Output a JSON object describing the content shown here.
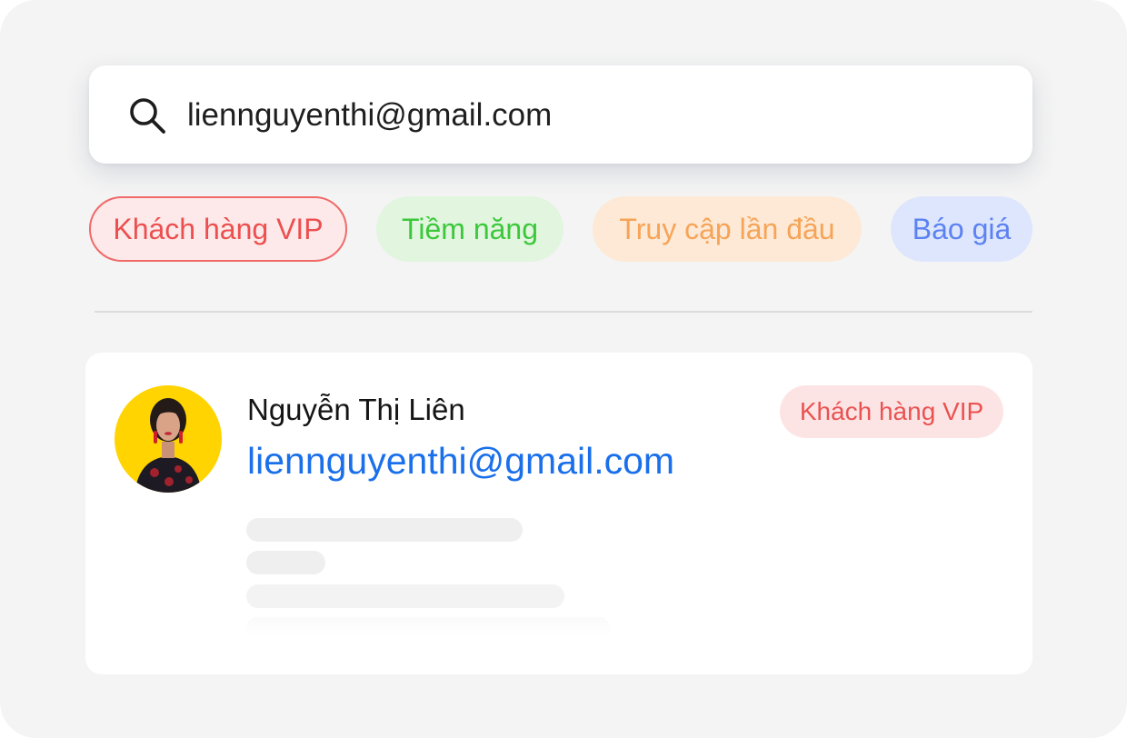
{
  "search": {
    "value": "liennguyenthi@gmail.com",
    "icon": "search-icon"
  },
  "tags": [
    {
      "label": "Khách hàng VIP",
      "color": "#ec4f4f"
    },
    {
      "label": "Tiềm năng",
      "color": "#3cc83a"
    },
    {
      "label": "Truy cập lần đầu",
      "color": "#f6a457"
    },
    {
      "label": "Báo giá",
      "color": "#5c82f2"
    }
  ],
  "result": {
    "name": "Nguyễn Thị Liên",
    "email": "liennguyenthi@gmail.com",
    "badge": "Khách hàng VIP",
    "email_color": "#1a6fea"
  },
  "colors": {
    "background": "#f4f4f4",
    "avatar_background": "#ffd400"
  }
}
